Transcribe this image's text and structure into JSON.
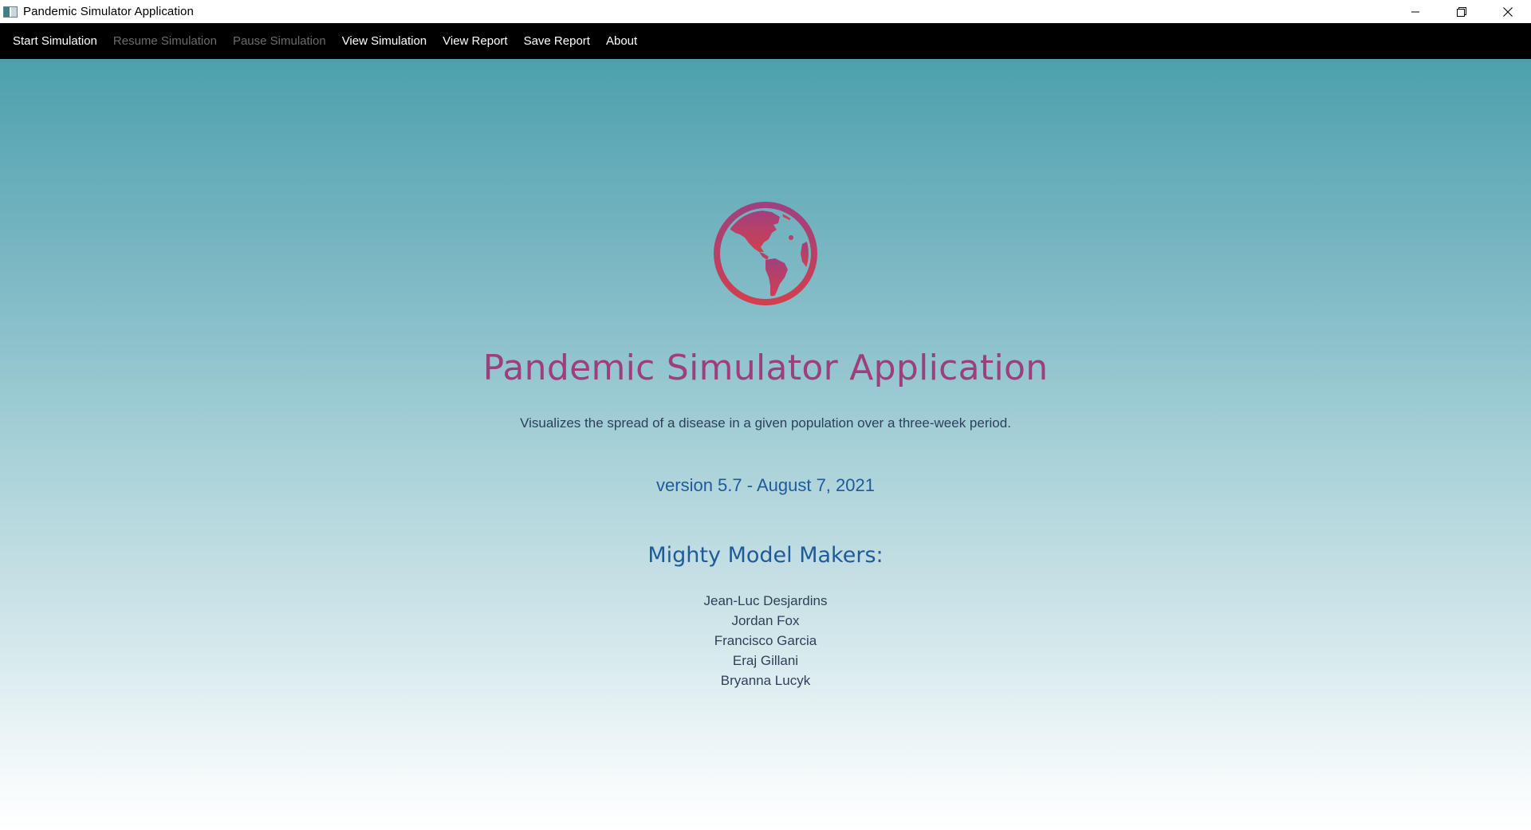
{
  "window": {
    "title": "Pandemic Simulator Application",
    "controls": {
      "minimize_icon": "minimize-icon",
      "restore_icon": "restore-icon",
      "close_icon": "close-icon"
    }
  },
  "menu": {
    "items": [
      {
        "label": "Start Simulation",
        "enabled": true
      },
      {
        "label": "Resume Simulation",
        "enabled": false
      },
      {
        "label": "Pause Simulation",
        "enabled": false
      },
      {
        "label": "View Simulation",
        "enabled": true
      },
      {
        "label": "View Report",
        "enabled": true
      },
      {
        "label": "Save Report",
        "enabled": true
      },
      {
        "label": "About",
        "enabled": true
      }
    ]
  },
  "about": {
    "logo_icon": "globe-americas-icon",
    "title": "Pandemic Simulator Application",
    "description": "Visualizes the spread of a disease in a given population over a three-week period.",
    "version": "version 5.7 - August 7, 2021",
    "makers_heading": "Mighty Model Makers:",
    "makers": [
      "Jean-Luc Desjardins",
      "Jordan Fox",
      "Francisco Garcia",
      "Eraj Gillani",
      "Bryanna Lucyk"
    ]
  },
  "colors": {
    "menubar_bg": "#000000",
    "menu_text": "#ffffff",
    "menu_text_disabled": "#6b6b6b",
    "title_color": "#9c3f7b",
    "accent_blue": "#1f5a9a",
    "body_text": "#2f3f5a",
    "gradient_top": "#4da0ad",
    "gradient_bottom": "#ffffff",
    "globe_top": "#a0407f",
    "globe_bottom": "#d23f4e"
  }
}
